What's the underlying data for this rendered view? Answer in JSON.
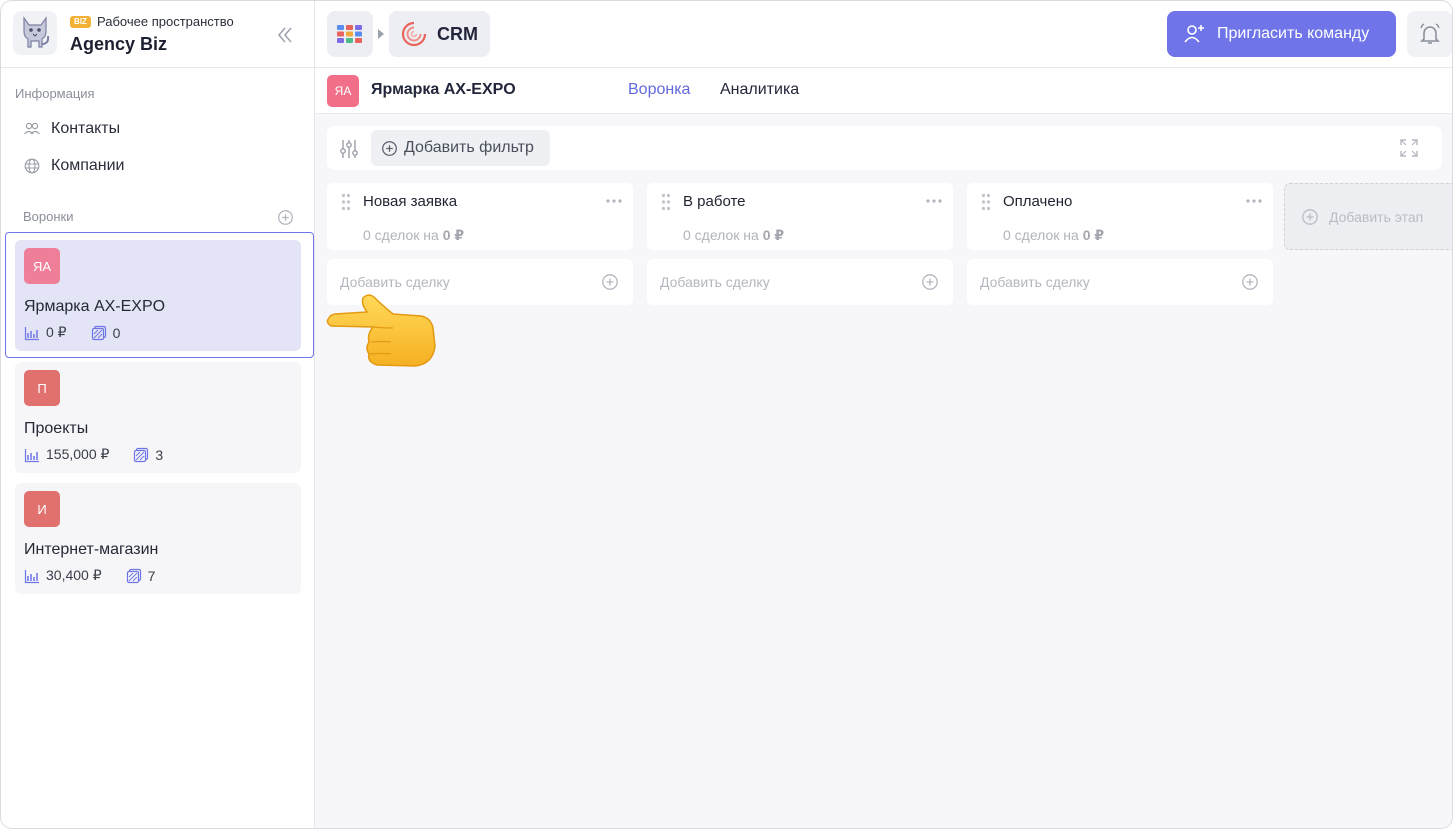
{
  "workspace": {
    "badge": "BIZ",
    "caption": "Рабочее пространство",
    "name": "Agency Biz"
  },
  "sidebar": {
    "info_label": "Информация",
    "nav": [
      {
        "label": "Контакты",
        "icon": "contacts-icon"
      },
      {
        "label": "Компании",
        "icon": "globe-icon"
      }
    ],
    "funnels_label": "Воронки",
    "funnels": [
      {
        "initials": "ЯА",
        "name": "Ярмарка AX-EXPO",
        "amount": "0 ₽",
        "deals": "0",
        "color": "#f26f8a",
        "active": true
      },
      {
        "initials": "П",
        "name": "Проекты",
        "amount": "155,000 ₽",
        "deals": "3",
        "color": "#e0716e",
        "active": false
      },
      {
        "initials": "И",
        "name": "Интернет-магазин",
        "amount": "30,400 ₽",
        "deals": "7",
        "color": "#e0716e",
        "active": false
      }
    ]
  },
  "topbar": {
    "app_label": "CRM",
    "invite_label": "Пригласить команду",
    "accent": "#6f75e8"
  },
  "subheader": {
    "initials": "ЯА",
    "title": "Ярмарка AX-EXPO",
    "tabs": [
      {
        "label": "Воронка",
        "active": true
      },
      {
        "label": "Аналитика",
        "active": false
      }
    ]
  },
  "board": {
    "add_filter_label": "Добавить фильтр",
    "stages": [
      {
        "name": "Новая заявка",
        "count_prefix": "0 сделок на",
        "amount": "0 ₽",
        "add_deal_label": "Добавить сделку"
      },
      {
        "name": "В работе",
        "count_prefix": "0 сделок на",
        "amount": "0 ₽",
        "add_deal_label": "Добавить сделку"
      },
      {
        "name": "Оплачено",
        "count_prefix": "0 сделок на",
        "amount": "0 ₽",
        "add_deal_label": "Добавить сделку"
      }
    ],
    "add_stage_label": "Добавить этап"
  },
  "overlay": {
    "pointer": "pointing-hand-emoji"
  }
}
